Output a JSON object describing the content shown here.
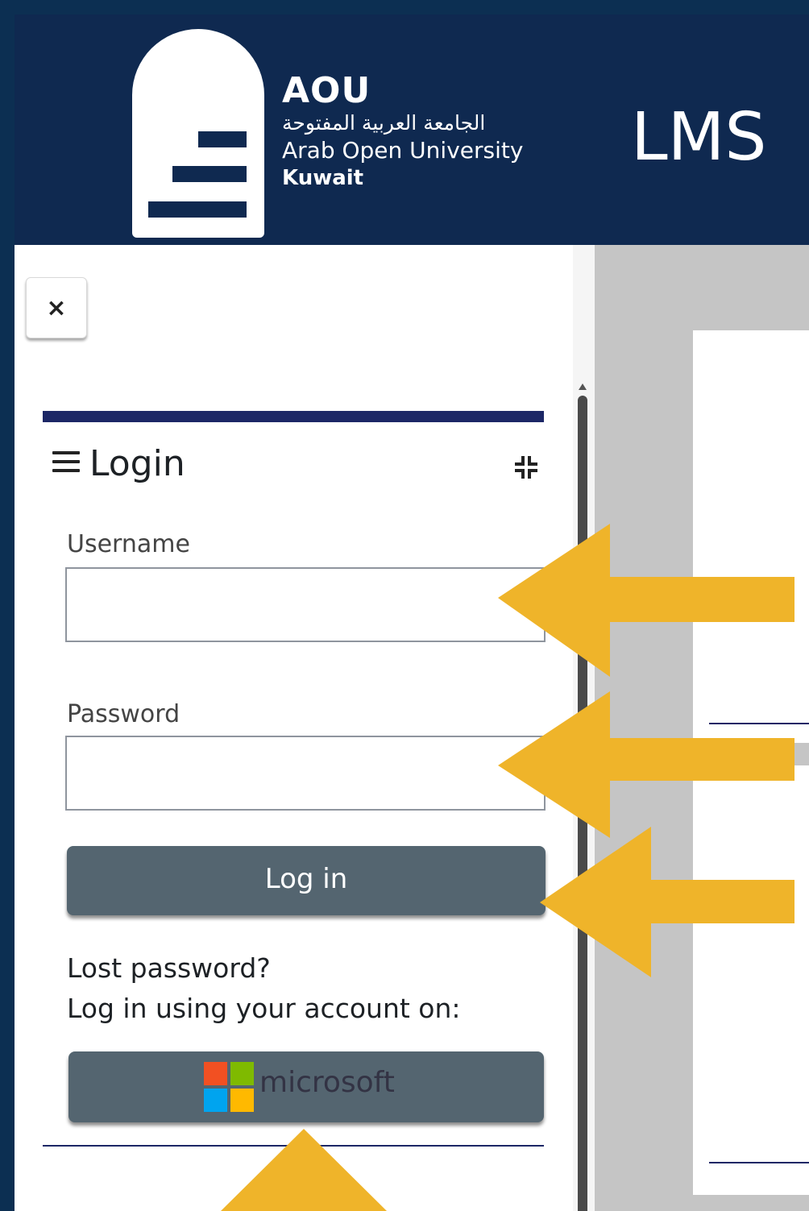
{
  "header": {
    "logo_title": "AOU",
    "logo_arabic": "الجامعة العربية المفتوحة",
    "logo_english": "Arab Open University",
    "logo_location": "Kuwait",
    "app_title": "LMS"
  },
  "drawer": {
    "close_label": "×",
    "block_title": "Login",
    "username_label": "Username",
    "username_value": "",
    "password_label": "Password",
    "password_value": "",
    "login_button": "Log in",
    "lost_password": "Lost password?",
    "oauth_prompt": "Log in using your account on:",
    "microsoft_button": "microsoft"
  },
  "colors": {
    "header_bg": "#0f2950",
    "button_bg": "#546570",
    "arrow": "#f0b429",
    "accent_line": "#1c2766"
  },
  "icons": [
    "close-icon",
    "hamburger-icon",
    "collapse-icon",
    "microsoft-logo-icon"
  ],
  "annotations": {
    "arrows": [
      "arrow-to-username",
      "arrow-to-password",
      "arrow-to-login",
      "arrow-to-microsoft"
    ]
  }
}
